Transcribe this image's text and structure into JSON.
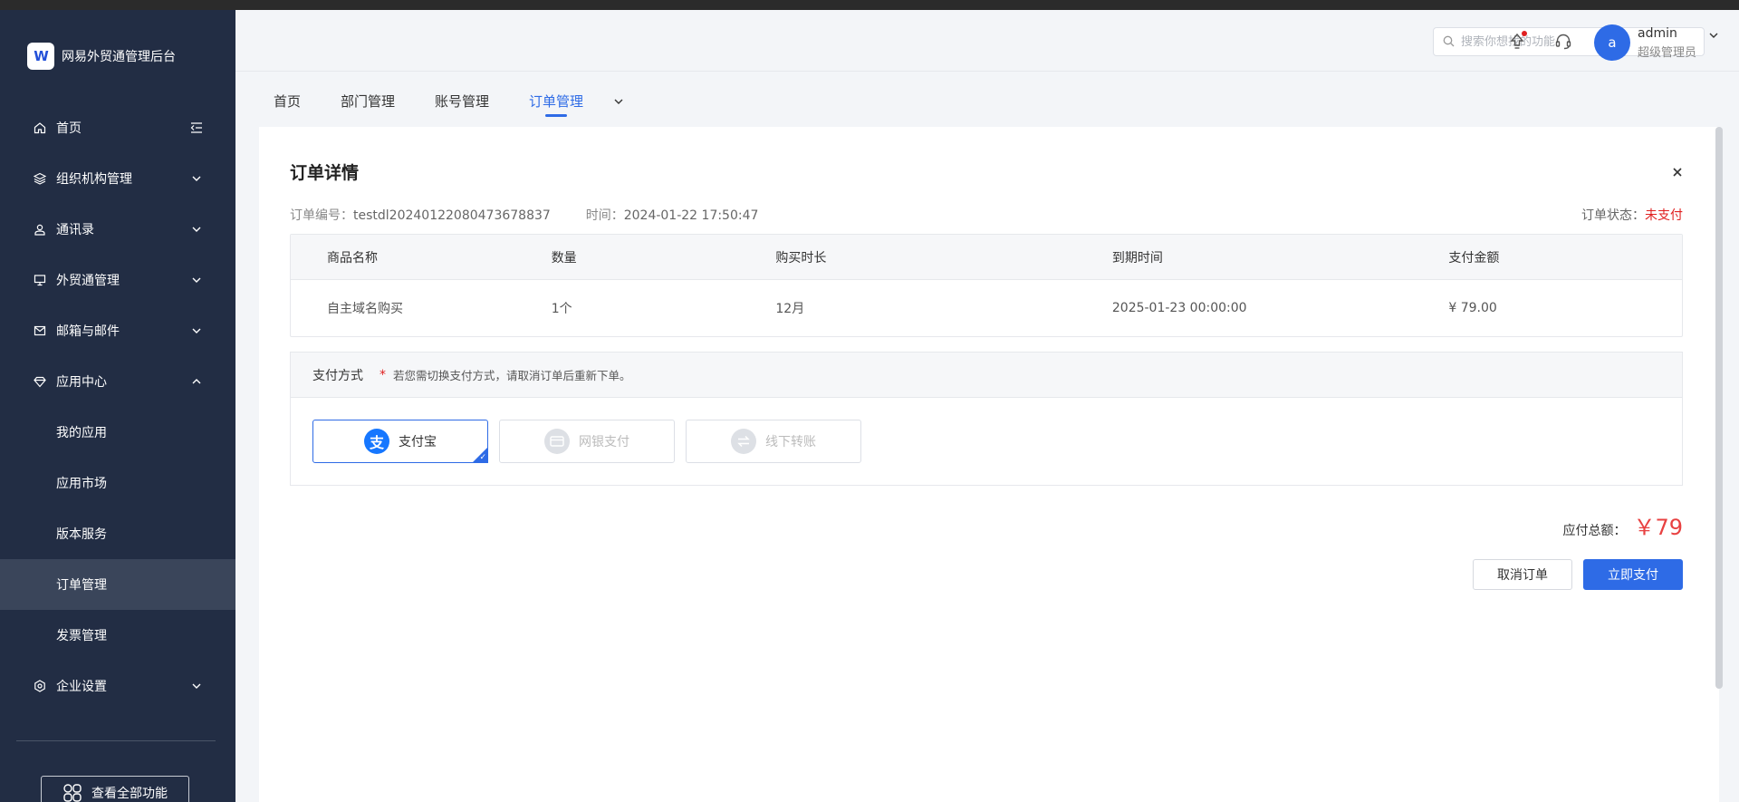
{
  "app": {
    "title": "网易外贸通管理后台",
    "logo_text": "W"
  },
  "sidebar": {
    "items": [
      {
        "label": "首页",
        "icon": "home-icon"
      },
      {
        "label": "组织机构管理",
        "icon": "layers-icon"
      },
      {
        "label": "通讯录",
        "icon": "contacts-icon"
      },
      {
        "label": "外贸通管理",
        "icon": "monitor-icon"
      },
      {
        "label": "邮箱与邮件",
        "icon": "mail-icon"
      },
      {
        "label": "应用中心",
        "icon": "gem-icon"
      },
      {
        "label": "我的应用"
      },
      {
        "label": "应用市场"
      },
      {
        "label": "版本服务"
      },
      {
        "label": "订单管理"
      },
      {
        "label": "发票管理"
      },
      {
        "label": "企业设置",
        "icon": "settings-icon"
      }
    ],
    "all_functions_label": "查看全部功能"
  },
  "header": {
    "search_placeholder": "搜索你想找的功能",
    "user": {
      "avatar_letter": "a",
      "name": "admin",
      "role": "超级管理员"
    }
  },
  "tabs": [
    "首页",
    "部门管理",
    "账号管理",
    "订单管理"
  ],
  "order": {
    "title": "订单详情",
    "number_label": "订单编号：",
    "number": "testdl20240122080473678837",
    "time_label": "时间：",
    "time": "2024-01-22 17:50:47",
    "status_label": "订单状态：",
    "status": "未支付",
    "columns": [
      "商品名称",
      "数量",
      "购买时长",
      "到期时间",
      "支付金额"
    ],
    "rows": [
      [
        "自主域名购买",
        "1个",
        "12月",
        "2025-01-23 00:00:00",
        "¥ 79.00"
      ]
    ]
  },
  "payment": {
    "label": "支付方式",
    "required_mark": "*",
    "tip": "若您需切换支付方式，请取消订单后重新下单。",
    "options": [
      {
        "label": "支付宝",
        "icon_glyph": "支"
      },
      {
        "label": "网银支付"
      },
      {
        "label": "线下转账"
      }
    ],
    "total_label": "应付总额：",
    "total": "￥79",
    "cancel_label": "取消订单",
    "pay_label": "立即支付"
  },
  "colors": {
    "sidebar_bg": "#222d44",
    "accent": "#2e6be6",
    "danger": "#e02020"
  }
}
